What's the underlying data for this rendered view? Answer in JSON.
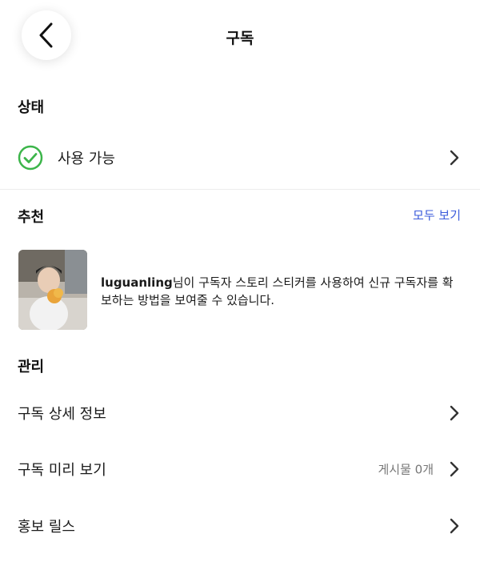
{
  "header": {
    "title": "구독"
  },
  "status": {
    "section_title": "상태",
    "value": "사용 가능"
  },
  "recommendations": {
    "section_title": "추천",
    "see_all": "모두 보기",
    "item": {
      "username": "luguanling",
      "text": "님이 구독자 스토리 스티커를 사용하여 신규 구독자를 확보하는 방법을 보여줄 수 있습니다."
    }
  },
  "manage": {
    "section_title": "관리",
    "items": [
      {
        "label": "구독 상세 정보",
        "meta": ""
      },
      {
        "label": "구독 미리 보기",
        "meta": "게시물 0개"
      },
      {
        "label": "홍보 릴스",
        "meta": ""
      }
    ]
  },
  "colors": {
    "accent": "#3b5bdb",
    "status_green": "#3cb54a"
  },
  "icons": [
    "back-arrow-icon",
    "check-circle-icon",
    "chevron-right-icon"
  ]
}
